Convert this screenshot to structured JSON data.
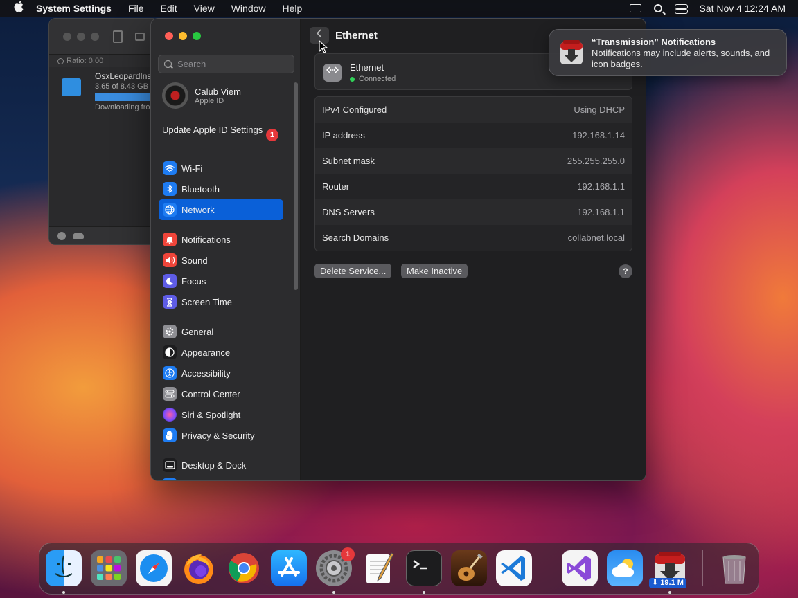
{
  "menubar": {
    "apple": "",
    "app_name": "System Settings",
    "items": [
      "File",
      "Edit",
      "View",
      "Window",
      "Help"
    ],
    "clock": "Sat Nov 4  12:24 AM"
  },
  "transmission_window": {
    "ratio": "Ratio: 0.00",
    "torrent_name": "OsxLeopardIns",
    "torrent_progress": "3.65 of 8.43 GB",
    "torrent_status": "Downloading fro"
  },
  "sidebar": {
    "search_placeholder": "Search",
    "account": {
      "name": "Calub Viem",
      "sub": "Apple ID"
    },
    "update": {
      "label": "Update Apple ID Settings",
      "badge": "1"
    },
    "items": [
      {
        "label": "Wi-Fi",
        "icon": "wifi-icon",
        "color": "#1e7cf2"
      },
      {
        "label": "Bluetooth",
        "icon": "bluetooth-icon",
        "color": "#1e7cf2"
      },
      {
        "label": "Network",
        "icon": "globe-icon",
        "color": "#1e7cf2"
      },
      {
        "label": "Notifications",
        "icon": "bell-icon",
        "color": "#f0453a"
      },
      {
        "label": "Sound",
        "icon": "speaker-icon",
        "color": "#f0453a"
      },
      {
        "label": "Focus",
        "icon": "moon-icon",
        "color": "#5e5ce6"
      },
      {
        "label": "Screen Time",
        "icon": "hourglass-icon",
        "color": "#5e5ce6"
      },
      {
        "label": "General",
        "icon": "gear-icon",
        "color": "#8e8e93"
      },
      {
        "label": "Appearance",
        "icon": "appearance-icon",
        "color": "#1c1c1e"
      },
      {
        "label": "Accessibility",
        "icon": "accessibility-icon",
        "color": "#1e7cf2"
      },
      {
        "label": "Control Center",
        "icon": "control-center-icon",
        "color": "#8e8e93"
      },
      {
        "label": "Siri & Spotlight",
        "icon": "siri-icon",
        "color": "#a040c0"
      },
      {
        "label": "Privacy & Security",
        "icon": "hand-icon",
        "color": "#1e7cf2"
      },
      {
        "label": "Desktop & Dock",
        "icon": "dock-icon",
        "color": "#1c1c1e"
      }
    ]
  },
  "content": {
    "title": "Ethernet",
    "device": {
      "name": "Ethernet",
      "status": "Connected"
    },
    "rows": [
      {
        "label": "IPv4 Configured",
        "value": "Using DHCP"
      },
      {
        "label": "IP address",
        "value": "192.168.1.14"
      },
      {
        "label": "Subnet mask",
        "value": "255.255.255.0"
      },
      {
        "label": "Router",
        "value": "192.168.1.1"
      },
      {
        "label": "DNS Servers",
        "value": "192.168.1.1"
      },
      {
        "label": "Search Domains",
        "value": "collabnet.local"
      }
    ],
    "delete_label": "Delete Service...",
    "inactive_label": "Make Inactive",
    "help_label": "?"
  },
  "notification": {
    "title": "“Transmission” Notifications",
    "body": "Notifications may include alerts, sounds, and icon badges."
  },
  "dock": {
    "settings_badge": "1",
    "transmission_label": "⬇ 19.1 M"
  }
}
